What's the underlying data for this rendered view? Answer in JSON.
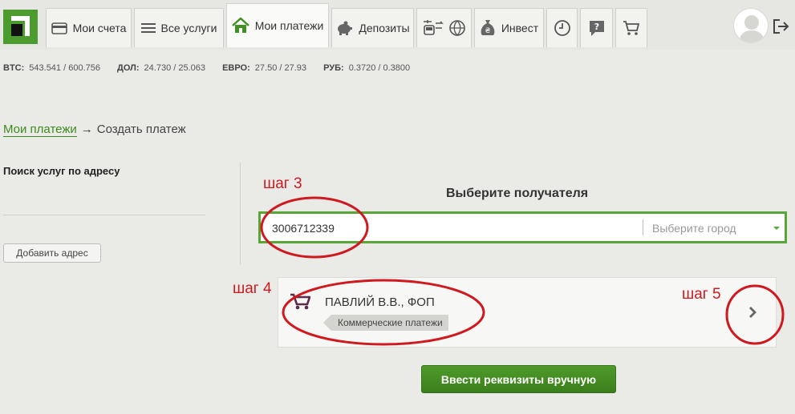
{
  "nav": {
    "tabs": [
      {
        "label": "Мои счета",
        "icon": "card-icon"
      },
      {
        "label": "Все услуги",
        "icon": "list-icon"
      },
      {
        "label": "Мои платежи",
        "icon": "home-icon"
      },
      {
        "label": "Депозиты",
        "icon": "piggy-bank-icon"
      },
      {
        "label": "",
        "icon": "transport-globe-icon"
      },
      {
        "label": "Инвест",
        "icon": "money-bag-icon"
      },
      {
        "label": "",
        "icon": "history-icon"
      },
      {
        "label": "",
        "icon": "help-icon"
      },
      {
        "label": "",
        "icon": "cart-icon"
      }
    ],
    "active_tab": "Мои платежи"
  },
  "rates": [
    {
      "key": "BTC:",
      "value": "543.541 / 600.756"
    },
    {
      "key": "ДОЛ:",
      "value": "24.730 / 25.063"
    },
    {
      "key": "ЕВРО:",
      "value": "27.50 / 27.93"
    },
    {
      "key": "РУБ:",
      "value": "0.3720 / 0.3800"
    }
  ],
  "breadcrumb": {
    "link": "Мои платежи",
    "arrow": "→",
    "current": "Создать платеж"
  },
  "sidebar": {
    "title": "Поиск услуг по адресу",
    "add_address_label": "Добавить адрес"
  },
  "main": {
    "title": "Выберите получателя",
    "search_value": "3006712339",
    "city_placeholder": "Выберите город",
    "result": {
      "name": "ПАВЛИЙ В.В., ФОП",
      "tag": "Коммерческие платежи"
    },
    "manual_button": "Ввести реквизиты вручную"
  },
  "annotations": {
    "step3": "шаг 3",
    "step4": "шаг 4",
    "step5": "шаг 5"
  },
  "colors": {
    "accent": "#4b9b2e",
    "annotation": "#d0181f"
  }
}
